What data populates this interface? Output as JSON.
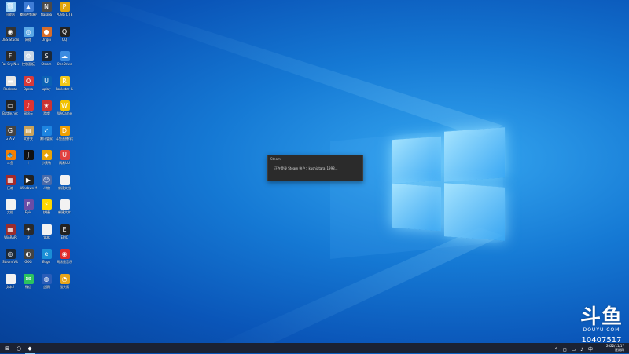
{
  "dialog": {
    "title": "Steam",
    "message": "正在登录 Steam 账户：kushiatara_1998..."
  },
  "desktop_icons": [
    {
      "label": "回收站",
      "color": "#9bd0f5",
      "symbol": "🗑"
    },
    {
      "label": "腾讯视频客户端",
      "color": "#3f7dd6",
      "symbol": "▲"
    },
    {
      "label": "Naraka",
      "color": "#4a4a4a",
      "symbol": "N"
    },
    {
      "label": "PUBG LITE",
      "color": "#e2a50d",
      "symbol": "P"
    },
    {
      "label": "OBS Studio",
      "color": "#333333",
      "symbol": "◉"
    },
    {
      "label": "网络",
      "color": "#5aa8e6",
      "symbol": "◎"
    },
    {
      "label": "Origin",
      "color": "#d66d2a",
      "symbol": "●"
    },
    {
      "label": "QQ",
      "color": "#222222",
      "symbol": "Q"
    },
    {
      "label": "Far Cry New Dawn",
      "color": "#2a2a2a",
      "symbol": "F"
    },
    {
      "label": "控制面板",
      "color": "#c9d7e6",
      "symbol": "⚙"
    },
    {
      "label": "Steam",
      "color": "#1b2838",
      "symbol": "S"
    },
    {
      "label": "OneDrive",
      "color": "#3b8be0",
      "symbol": "☁"
    },
    {
      "label": "Rockstar",
      "color": "#e5e5e5",
      "symbol": "▬"
    },
    {
      "label": "Opera",
      "color": "#d83a3a",
      "symbol": "O"
    },
    {
      "label": "uplay",
      "color": "#0b61b4",
      "symbol": "U"
    },
    {
      "label": "Rockstar Games",
      "color": "#f3c81a",
      "symbol": "R"
    },
    {
      "label": "Battle.net",
      "color": "#222222",
      "symbol": "▭"
    },
    {
      "label": "网易云",
      "color": "#d33",
      "symbol": "♪"
    },
    {
      "label": "游戏",
      "color": "#c33",
      "symbol": "★"
    },
    {
      "label": "WeGame",
      "color": "#f2c200",
      "symbol": "W"
    },
    {
      "label": "GTA V",
      "color": "#444",
      "symbol": "G"
    },
    {
      "label": "文件夹",
      "color": "#caa35a",
      "symbol": "▤"
    },
    {
      "label": "腾讯管家",
      "color": "#1d84e0",
      "symbol": "✓"
    },
    {
      "label": "斗鱼直播伴侣",
      "color": "#f2a000",
      "symbol": "D"
    },
    {
      "label": "斗鱼",
      "color": "#f47f00",
      "symbol": "🐟"
    },
    {
      "label": "J",
      "color": "#111",
      "symbol": "J"
    },
    {
      "label": "小黄鸭",
      "color": "#e8a30a",
      "symbol": "◆"
    },
    {
      "label": "网易UU",
      "color": "#e04040",
      "symbol": "U"
    },
    {
      "label": "压缩",
      "color": "#a52a2a",
      "symbol": "▦"
    },
    {
      "label": "Windows Media",
      "color": "#222",
      "symbol": "▶"
    },
    {
      "label": "人物",
      "color": "#4a6aa8",
      "symbol": "☺"
    },
    {
      "label": "新建文档",
      "color": "#f2f2f2",
      "symbol": " "
    },
    {
      "label": "文档",
      "color": "#f2f2f2",
      "symbol": " "
    },
    {
      "label": "Epic",
      "color": "#6b4da6",
      "symbol": "E"
    },
    {
      "label": "快捷",
      "color": "#ffd800",
      "symbol": "⚡"
    },
    {
      "label": "新建文本",
      "color": "#f2f2f2",
      "symbol": " "
    },
    {
      "label": "WinRAR",
      "color": "#9b2c2c",
      "symbol": "▦"
    },
    {
      "label": "龙",
      "color": "#2a2a2a",
      "symbol": "✦"
    },
    {
      "label": "文本",
      "color": "#f2f2f2",
      "symbol": " "
    },
    {
      "label": "EPIC",
      "color": "#222",
      "symbol": "E"
    },
    {
      "label": "Steam VR",
      "color": "#1b2838",
      "symbol": "◎"
    },
    {
      "label": "GOG",
      "color": "#444",
      "symbol": "◐"
    },
    {
      "label": "Edge",
      "color": "#1a8fd6",
      "symbol": "e"
    },
    {
      "label": "网易云音乐",
      "color": "#e02b2b",
      "symbol": "◉"
    },
    {
      "label": "文本2",
      "color": "#f2f2f2",
      "symbol": " "
    },
    {
      "label": "微信",
      "color": "#2cc45e",
      "symbol": "✉"
    },
    {
      "label": "企鹅",
      "color": "#2a5db8",
      "symbol": "◍"
    },
    {
      "label": "猫头鹰",
      "color": "#e7a51c",
      "symbol": "◔"
    }
  ],
  "taskbar": {
    "start_icon": "⊞",
    "search_icon": "○",
    "app_icon": "◆",
    "tray_icons": "⌃ ◻ ▭ ♪ 中",
    "time": "2022/11/17",
    "date_line": "星期四"
  },
  "watermark": {
    "logo": "斗鱼",
    "brand": "DOUYU.COM",
    "room_id": "10407517"
  }
}
